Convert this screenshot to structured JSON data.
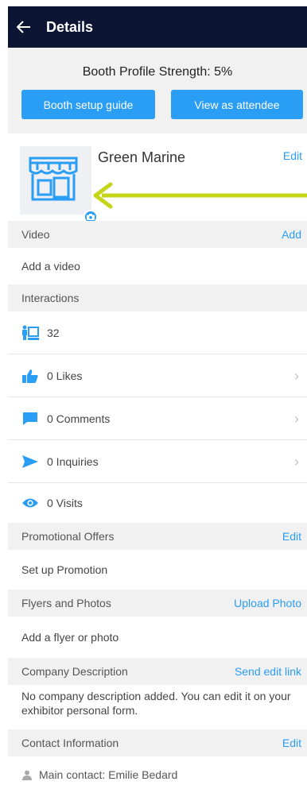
{
  "header": {
    "title": "Details",
    "back_icon": "arrow-left-icon"
  },
  "strength": {
    "text": "Booth Profile Strength: 5%",
    "guide_label": "Booth setup guide",
    "view_label": "View as attendee"
  },
  "profile": {
    "company": "Green Marine",
    "edit": "Edit",
    "logo_icon": "storefront-icon",
    "camera_icon": "camera-icon"
  },
  "video": {
    "header": "Video",
    "action": "Add",
    "row": "Add a video"
  },
  "interactions": {
    "header": "Interactions",
    "rows": [
      {
        "icon": "booth-people-icon",
        "label": "32"
      },
      {
        "icon": "thumbs-up-icon",
        "label": "0 Likes"
      },
      {
        "icon": "comment-icon",
        "label": "0 Comments"
      },
      {
        "icon": "send-icon",
        "label": "0 Inquiries"
      },
      {
        "icon": "eye-icon",
        "label": "0 Visits"
      }
    ]
  },
  "promotional": {
    "header": "Promotional Offers",
    "action": "Edit",
    "row": "Set up Promotion"
  },
  "flyers": {
    "header": "Flyers and Photos",
    "action": "Upload Photo",
    "row": "Add a flyer or photo"
  },
  "description": {
    "header": "Company Description",
    "action": "Send edit link",
    "text": "No company description added. You can edit it on your exhibitor personal form."
  },
  "contact": {
    "header": "Contact Information",
    "action": "Edit",
    "row": "Main contact: Emilie Bedard",
    "icon": "person-icon"
  },
  "colors": {
    "navbar": "#0c1533",
    "accent": "#2a9df4",
    "annotation_arrow": "#c5d61a",
    "section_bg": "#f1f1f1"
  }
}
